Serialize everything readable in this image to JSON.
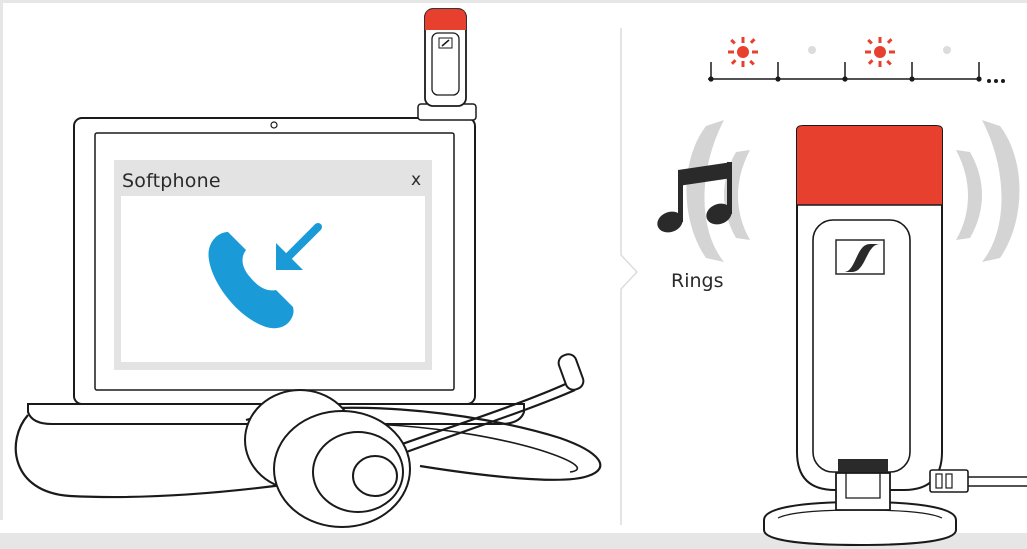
{
  "softphone": {
    "title": "Softphone",
    "close_label": "x"
  },
  "status": {
    "label": "Rings"
  },
  "colors": {
    "accent_red": "#e8402f",
    "call_blue": "#1a9bd7",
    "outline": "#1a1a1a",
    "panel_gray": "#e3e3e3",
    "signal_gray": "#d4d4d4"
  },
  "icons": {
    "call": "incoming-call-icon",
    "music": "music-note-icon",
    "led": "led-blink-icon",
    "brand": "sennheiser-logo-icon"
  }
}
